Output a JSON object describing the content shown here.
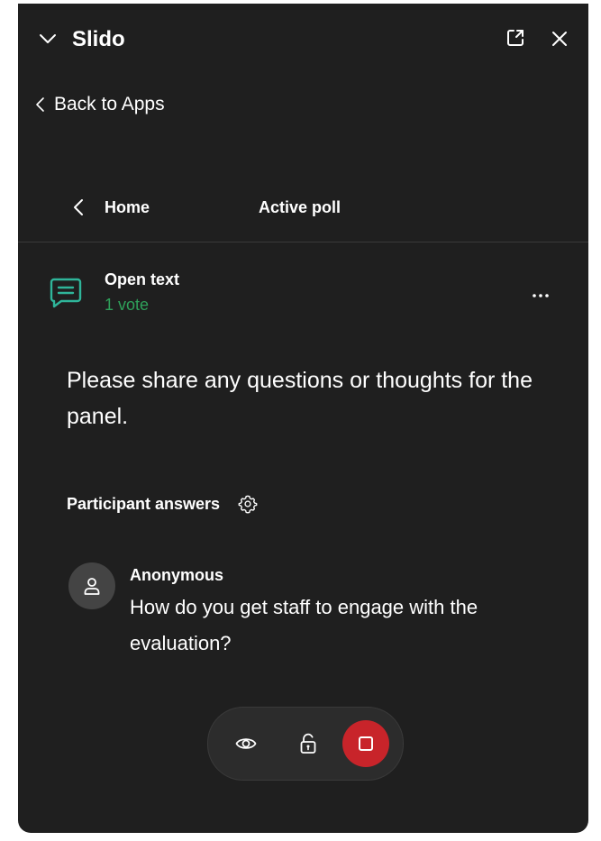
{
  "app": {
    "title": "Slido",
    "icons": [
      "chevron-down-icon",
      "popout-icon",
      "close-icon"
    ]
  },
  "back_link": {
    "label": "Back to Apps",
    "icon": "chevron-left-icon"
  },
  "nav": {
    "home_label": "Home",
    "active_label": "Active poll"
  },
  "poll": {
    "type": "Open text",
    "votes": "1 vote",
    "question": "Please share any questions or thoughts for the panel.",
    "icon": "message-lines-icon"
  },
  "answers": {
    "header": "Participant answers",
    "items": [
      {
        "author": "Anonymous",
        "text": "How do you get staff to engage with the evaluation?"
      }
    ]
  },
  "controls": {
    "icons": [
      "eye-icon",
      "unlock-icon",
      "stop-icon"
    ]
  },
  "colors": {
    "background": "#1f1f1f",
    "accent_green": "#2ea05a",
    "icon_teal": "#2fb59a",
    "stop_red": "#c8242a"
  }
}
